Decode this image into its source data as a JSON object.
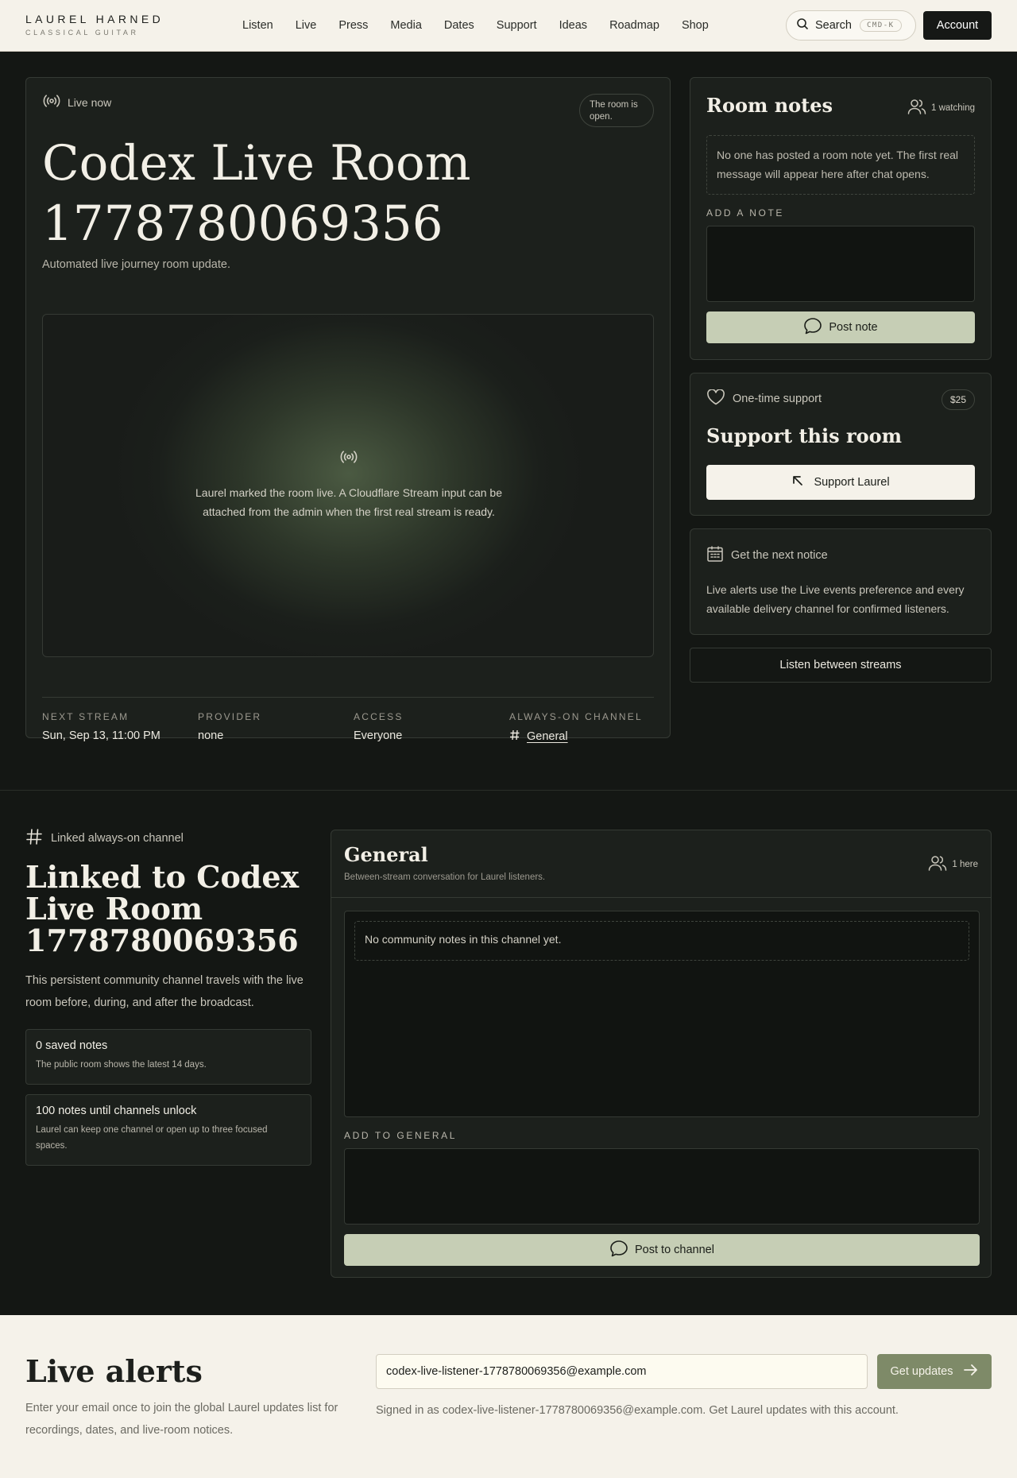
{
  "header": {
    "brand_name": "LAUREL HARNED",
    "brand_sub": "CLASSICAL GUITAR",
    "nav": [
      "Listen",
      "Live",
      "Press",
      "Media",
      "Dates",
      "Support",
      "Ideas",
      "Roadmap",
      "Shop"
    ],
    "search_label": "Search",
    "search_shortcut": "CMD-K",
    "account_label": "Account"
  },
  "room": {
    "status": "Live now",
    "open_badge": "The room is open.",
    "title": "Codex Live Room 1778780069356",
    "subtitle": "Automated live journey room update.",
    "player_message": "Laurel marked the room live. A Cloudflare Stream input can be attached from the admin when the first real stream is ready.",
    "meta": [
      {
        "key": "NEXT STREAM",
        "value": "Sun, Sep 13, 11:00 PM"
      },
      {
        "key": "PROVIDER",
        "value": "none"
      },
      {
        "key": "ACCESS",
        "value": "Everyone"
      },
      {
        "key": "ALWAYS-ON CHANNEL",
        "value": "General"
      }
    ]
  },
  "notes": {
    "title": "Room notes",
    "watching": "1 watching",
    "empty": "No one has posted a room note yet. The first real message will appear here after chat opens.",
    "add_label": "ADD A NOTE",
    "post_label": "Post note"
  },
  "support": {
    "tag": "One-time support",
    "amount": "$25",
    "title": "Support this room",
    "button": "Support Laurel"
  },
  "notice": {
    "tag": "Get the next notice",
    "text": "Live alerts use the Live events preference and every available delivery channel for confirmed listeners."
  },
  "between_label": "Listen between streams",
  "linked": {
    "tag": "Linked always-on channel",
    "title": "Linked to Codex Live Room 1778780069356",
    "desc": "This persistent community channel travels with the live room before, during, and after the broadcast.",
    "stats": [
      {
        "head": "0 saved notes",
        "body": "The public room shows the latest 14 days."
      },
      {
        "head": "100 notes until channels unlock",
        "body": "Laurel can keep one channel or open up to three focused spaces."
      }
    ]
  },
  "channel": {
    "name": "General",
    "desc": "Between-stream conversation for Laurel listeners.",
    "here": "1 here",
    "empty": "No community notes in this channel yet.",
    "add_label": "ADD TO GENERAL",
    "post_label": "Post to channel"
  },
  "alerts": {
    "title": "Live alerts",
    "desc": "Enter your email once to join the global Laurel updates list for recordings, dates, and live-room notices.",
    "email": "codex-live-listener-1778780069356@example.com",
    "button": "Get updates",
    "signed_in": "Signed in as codex-live-listener-1778780069356@example.com. Get Laurel updates with this account."
  }
}
